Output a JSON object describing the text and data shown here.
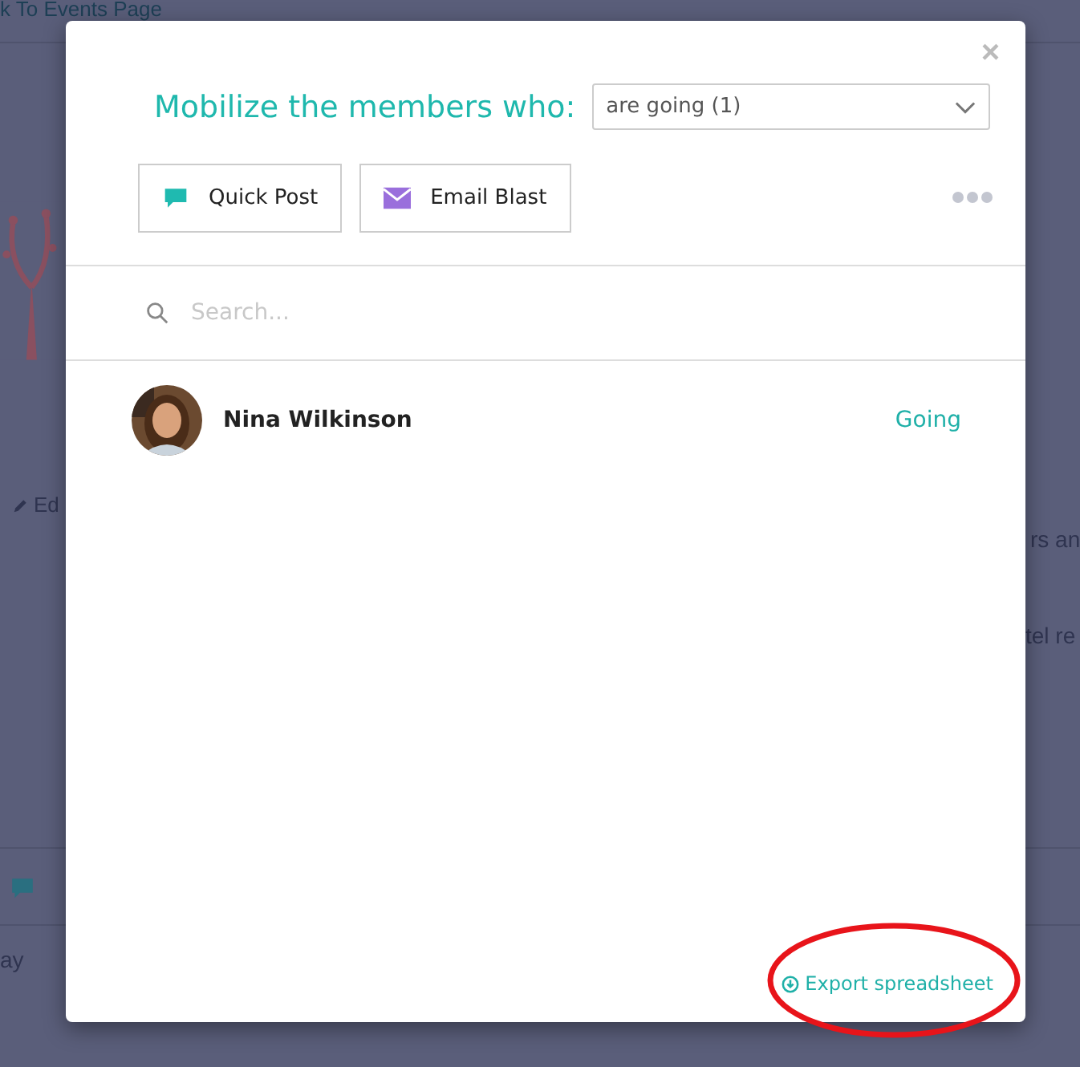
{
  "background_page": {
    "back_link": "k To Events Page",
    "edit_link": "Ed",
    "text_fragments": [
      "rs an",
      "tel re",
      "ay"
    ]
  },
  "modal": {
    "close": "×",
    "heading": "Mobilize the members who:",
    "filter": {
      "value": "are going (1)"
    },
    "actions": [
      {
        "kind": "post",
        "label": "Quick Post"
      },
      {
        "kind": "email",
        "label": "Email Blast"
      }
    ],
    "search": {
      "placeholder": "Search..."
    },
    "members": [
      {
        "name": "Nina Wilkinson",
        "status": "Going"
      }
    ],
    "export_link": "Export spreadsheet"
  }
}
